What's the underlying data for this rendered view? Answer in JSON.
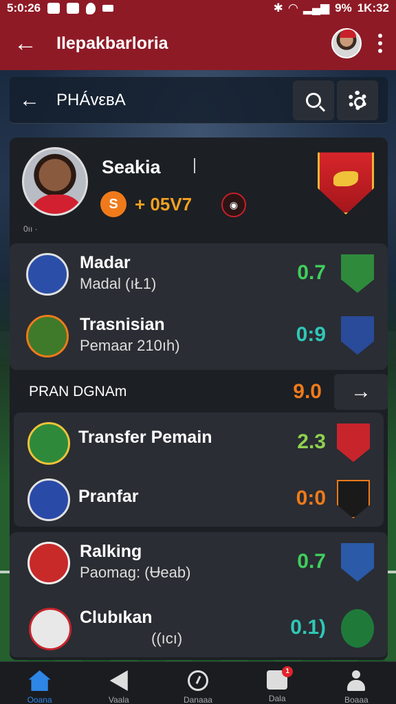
{
  "status_bar": {
    "time": "5:0:26",
    "battery": "9%",
    "clock_right": "1K:32"
  },
  "app_bar": {
    "title": "Ilepakbarloria"
  },
  "sub_bar": {
    "title": "PHÁvεвA"
  },
  "profile": {
    "name": "Seakia",
    "points": "+ 05V7",
    "badge_glyph": "S",
    "tiny_text": "0ıı ·"
  },
  "rows_top": [
    {
      "title": "Madar",
      "subtitle": "Madal (ıŁ1)",
      "score": "0.7",
      "score_color": "#3fcf5c",
      "crest_bg": "#2b4fa8",
      "opp_bg": "#2f8a3c"
    },
    {
      "title": "Trasnisian",
      "subtitle": "Pemaar 210ıh)",
      "score": "0:9",
      "score_color": "#2fc7b8",
      "crest_bg": "#3f7a2a",
      "opp_bg": "#2a4a9a"
    }
  ],
  "section": {
    "title": "PRAN DGNAm",
    "score": "9.0"
  },
  "rows_mid": [
    {
      "title": "Transfer Pemain",
      "subtitle": "",
      "score": "2.3",
      "score_color": "#8fd14f",
      "crest_bg": "#2e8a3a",
      "opp_bg": "#c8242c"
    },
    {
      "title": "Pranfar",
      "subtitle": "",
      "score": "0:0",
      "score_color": "#f07a1a",
      "crest_bg": "#2a4aa8",
      "opp_bg": "#1a1a1a"
    }
  ],
  "rows_bottom": [
    {
      "title": "Ralking",
      "subtitle": "Paomag: (Ʉeab)",
      "score": "0.7",
      "score_color": "#3fcf5c",
      "crest_bg": "#c82a2a",
      "opp_bg": "#2a5aa8"
    },
    {
      "title": "Clubıkan",
      "subtitle": "((ıcı)",
      "score": "0.1)",
      "score_color": "#2fc7b8",
      "crest_bg": "#e8e8e8",
      "opp_bg": "#1f7a3a"
    }
  ],
  "bottom_nav": [
    {
      "label": "Ooana",
      "icon": "home-icon"
    },
    {
      "label": "Vaala",
      "icon": "play-icon"
    },
    {
      "label": "Danaaa",
      "icon": "clock-icon"
    },
    {
      "label": "Dala",
      "icon": "message-icon",
      "badge": "1"
    },
    {
      "label": "Boaaa",
      "icon": "user-icon"
    }
  ],
  "colors": {
    "brand": "#8e1a26",
    "active_nav": "#2e86e6"
  }
}
